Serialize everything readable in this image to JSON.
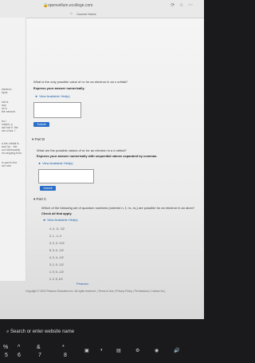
{
  "browser": {
    "url": "openvellum.ecollege.com",
    "course_home": "Course Home"
  },
  "left_strip": {
    "lines": [
      "electron,",
      "kpus",
      "hat is",
      "any",
      "ns a",
      "the second",
      "tor l",
      "ndded, a",
      "ard hat 5. the",
      "nts a has. f",
      "a the orbital is",
      "and 3p... the",
      "uct necessarily",
      "ne-sepping from",
      "in part in the",
      "ner retn"
    ]
  },
  "partA": {
    "question": "What is the only possible value of mₗ for an electron in an s orbital?",
    "instruction": "Express your answer numerically.",
    "hint": "► View Available Hint(s)",
    "submit": "Submit"
  },
  "partB": {
    "label": "Part B",
    "question": "What are the possible values of mₗ for an electron in a d orbital?",
    "instruction": "Express your answer numerically with sequential values separated by commas.",
    "hint": "► View Available Hint(s)",
    "submit": "Submit"
  },
  "partC": {
    "label": "Part C",
    "question": "Which of the following set of quantum numbers (ordered n, ℓ, mₗ, mₛ) are possible for an electron in an atom?",
    "check": "Check all that apply.",
    "hint": "► View Available Hint(s)",
    "options": [
      "4, 4, -3, -1/2",
      "2, 1, -1, 0",
      "3, 2, 3, +1/2",
      "5, 3, 0, -1/2",
      "4, 2, 4, -1/2",
      "3, 1, 0, -1/2",
      "1, 0, 0, -1/2",
      "2, 2, 0, 1/2"
    ]
  },
  "footer": {
    "brand": "Pearson",
    "copyright": "Copyright © 2022 Pearson Education Inc. All rights reserved. | Terms of Use | Privacy Policy | Permissions | Contact Us |"
  },
  "taskbar": {
    "search": "Search or enter website name"
  },
  "keyboard": {
    "keys": [
      "%",
      "5",
      "^",
      "6",
      "&",
      "7",
      "*",
      "8"
    ]
  }
}
